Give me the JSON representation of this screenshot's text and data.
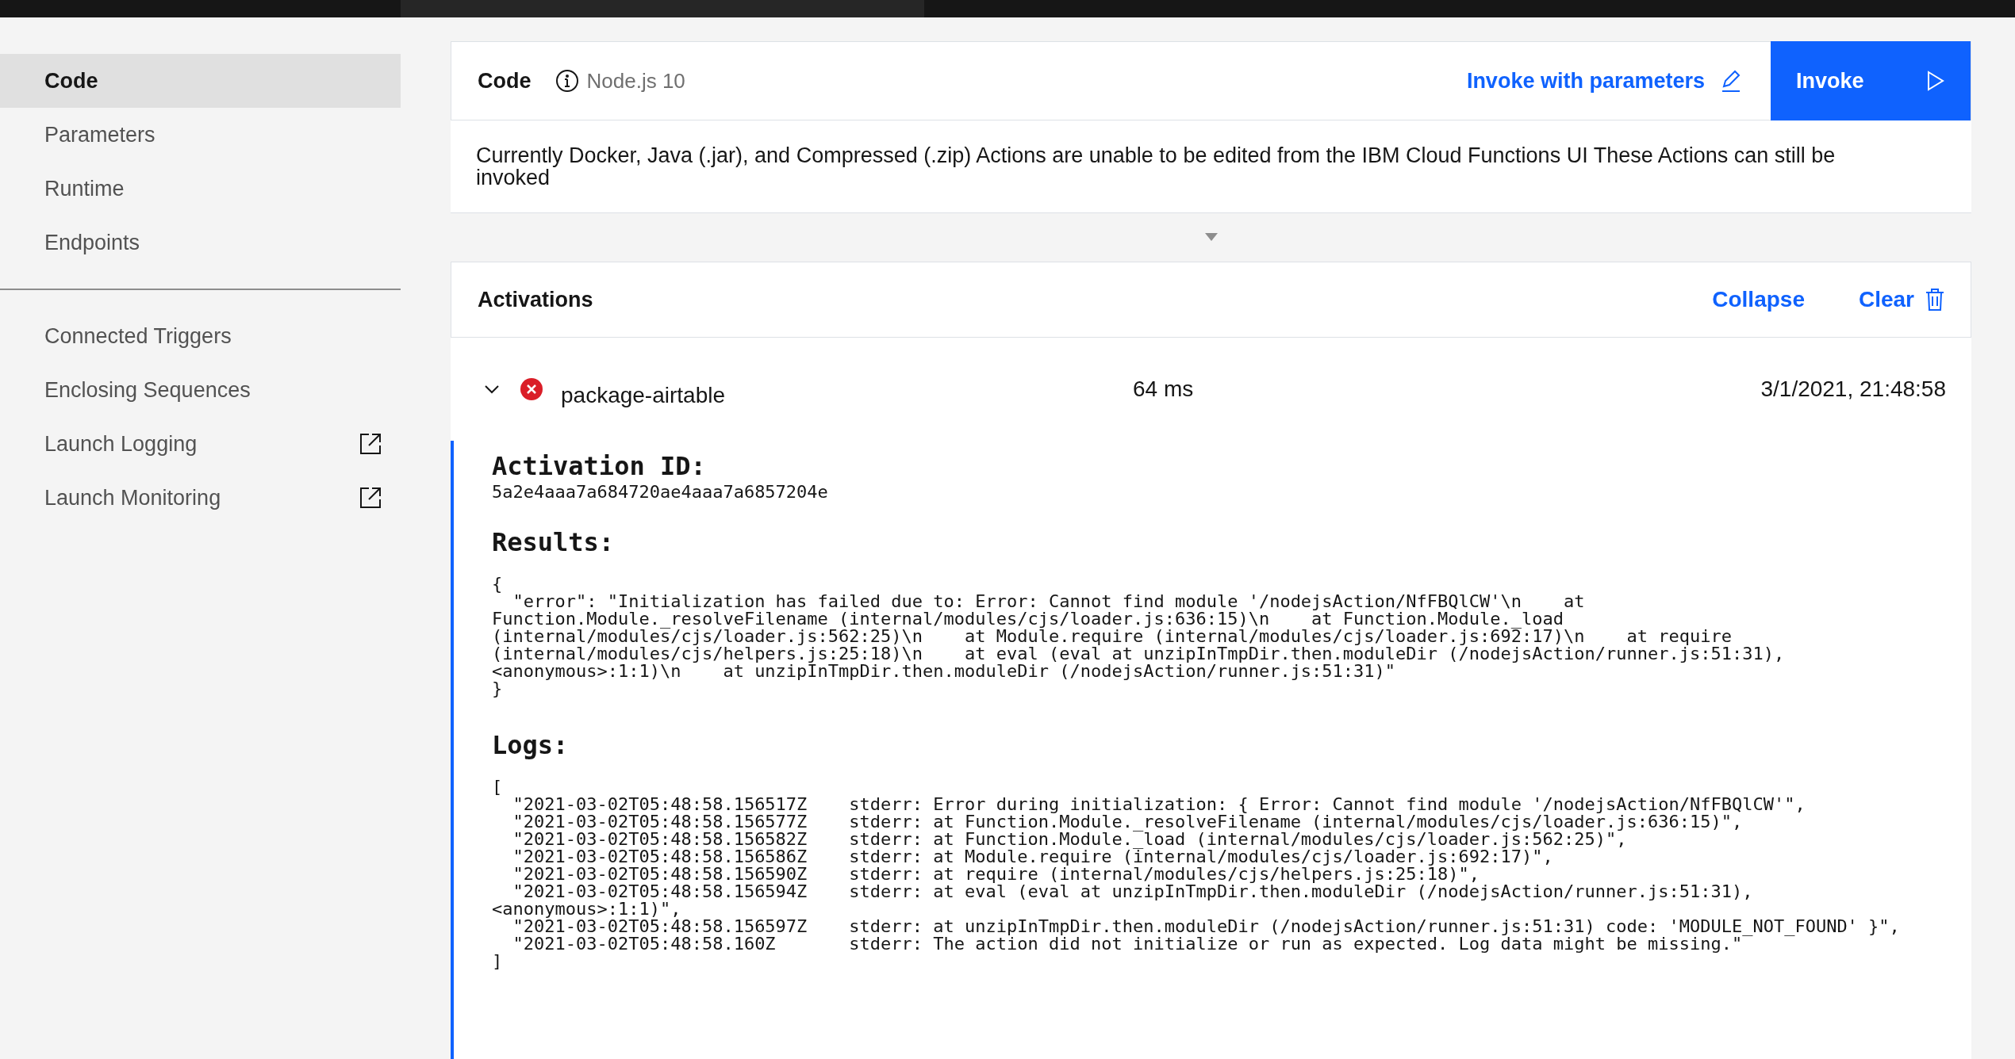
{
  "sidebar": {
    "groups": [
      {
        "items": [
          {
            "label": "Code",
            "selected": true,
            "external": false
          },
          {
            "label": "Parameters",
            "selected": false,
            "external": false
          },
          {
            "label": "Runtime",
            "selected": false,
            "external": false
          },
          {
            "label": "Endpoints",
            "selected": false,
            "external": false
          }
        ]
      },
      {
        "items": [
          {
            "label": "Connected Triggers",
            "selected": false,
            "external": false
          },
          {
            "label": "Enclosing Sequences",
            "selected": false,
            "external": false
          },
          {
            "label": "Launch Logging",
            "selected": false,
            "external": true
          },
          {
            "label": "Launch Monitoring",
            "selected": false,
            "external": true
          }
        ]
      }
    ]
  },
  "code_panel": {
    "title": "Code",
    "runtime": "Node.js 10",
    "invoke_with_parameters": "Invoke with parameters",
    "invoke": "Invoke",
    "notice": "Currently Docker, Java (.jar), and Compressed (.zip) Actions are unable to be edited from the IBM Cloud Functions UI These Actions can still be invoked"
  },
  "activations": {
    "title": "Activations",
    "collapse": "Collapse",
    "clear": "Clear",
    "entries": [
      {
        "expanded": true,
        "kind": "error",
        "name": "package-airtable",
        "duration": "64 ms",
        "timestamp": "3/1/2021, 21:48:58",
        "activation_id_label": "Activation ID:",
        "activation_id": "5a2e4aaa7a684720ae4aaa7a6857204e",
        "results_label": "Results:",
        "results_lines": [
          "{",
          "  \"error\": \"Initialization has failed due to: Error: Cannot find module '/nodejsAction/NfFBQlCW'\\n    at",
          "Function.Module._resolveFilename (internal/modules/cjs/loader.js:636:15)\\n    at Function.Module._load",
          "(internal/modules/cjs/loader.js:562:25)\\n    at Module.require (internal/modules/cjs/loader.js:692:17)\\n    at require",
          "(internal/modules/cjs/helpers.js:25:18)\\n    at eval (eval at unzipInTmpDir.then.moduleDir (/nodejsAction/runner.js:51:31),",
          "<anonymous>:1:1)\\n    at unzipInTmpDir.then.moduleDir (/nodejsAction/runner.js:51:31)\"",
          "}"
        ],
        "logs_label": "Logs:",
        "logs_lines": [
          "[",
          "  \"2021-03-02T05:48:58.156517Z    stderr: Error during initialization: { Error: Cannot find module '/nodejsAction/NfFBQlCW'\",",
          "  \"2021-03-02T05:48:58.156577Z    stderr: at Function.Module._resolveFilename (internal/modules/cjs/loader.js:636:15)\",",
          "  \"2021-03-02T05:48:58.156582Z    stderr: at Function.Module._load (internal/modules/cjs/loader.js:562:25)\",",
          "  \"2021-03-02T05:48:58.156586Z    stderr: at Module.require (internal/modules/cjs/loader.js:692:17)\",",
          "  \"2021-03-02T05:48:58.156590Z    stderr: at require (internal/modules/cjs/helpers.js:25:18)\",",
          "  \"2021-03-02T05:48:58.156594Z    stderr: at eval (eval at unzipInTmpDir.then.moduleDir (/nodejsAction/runner.js:51:31),",
          "<anonymous>:1:1)\",",
          "  \"2021-03-02T05:48:58.156597Z    stderr: at unzipInTmpDir.then.moduleDir (/nodejsAction/runner.js:51:31) code: 'MODULE_NOT_FOUND' }\",",
          "  \"2021-03-02T05:48:58.160Z       stderr: The action did not initialize or run as expected. Log data might be missing.\"",
          "]"
        ]
      }
    ]
  }
}
